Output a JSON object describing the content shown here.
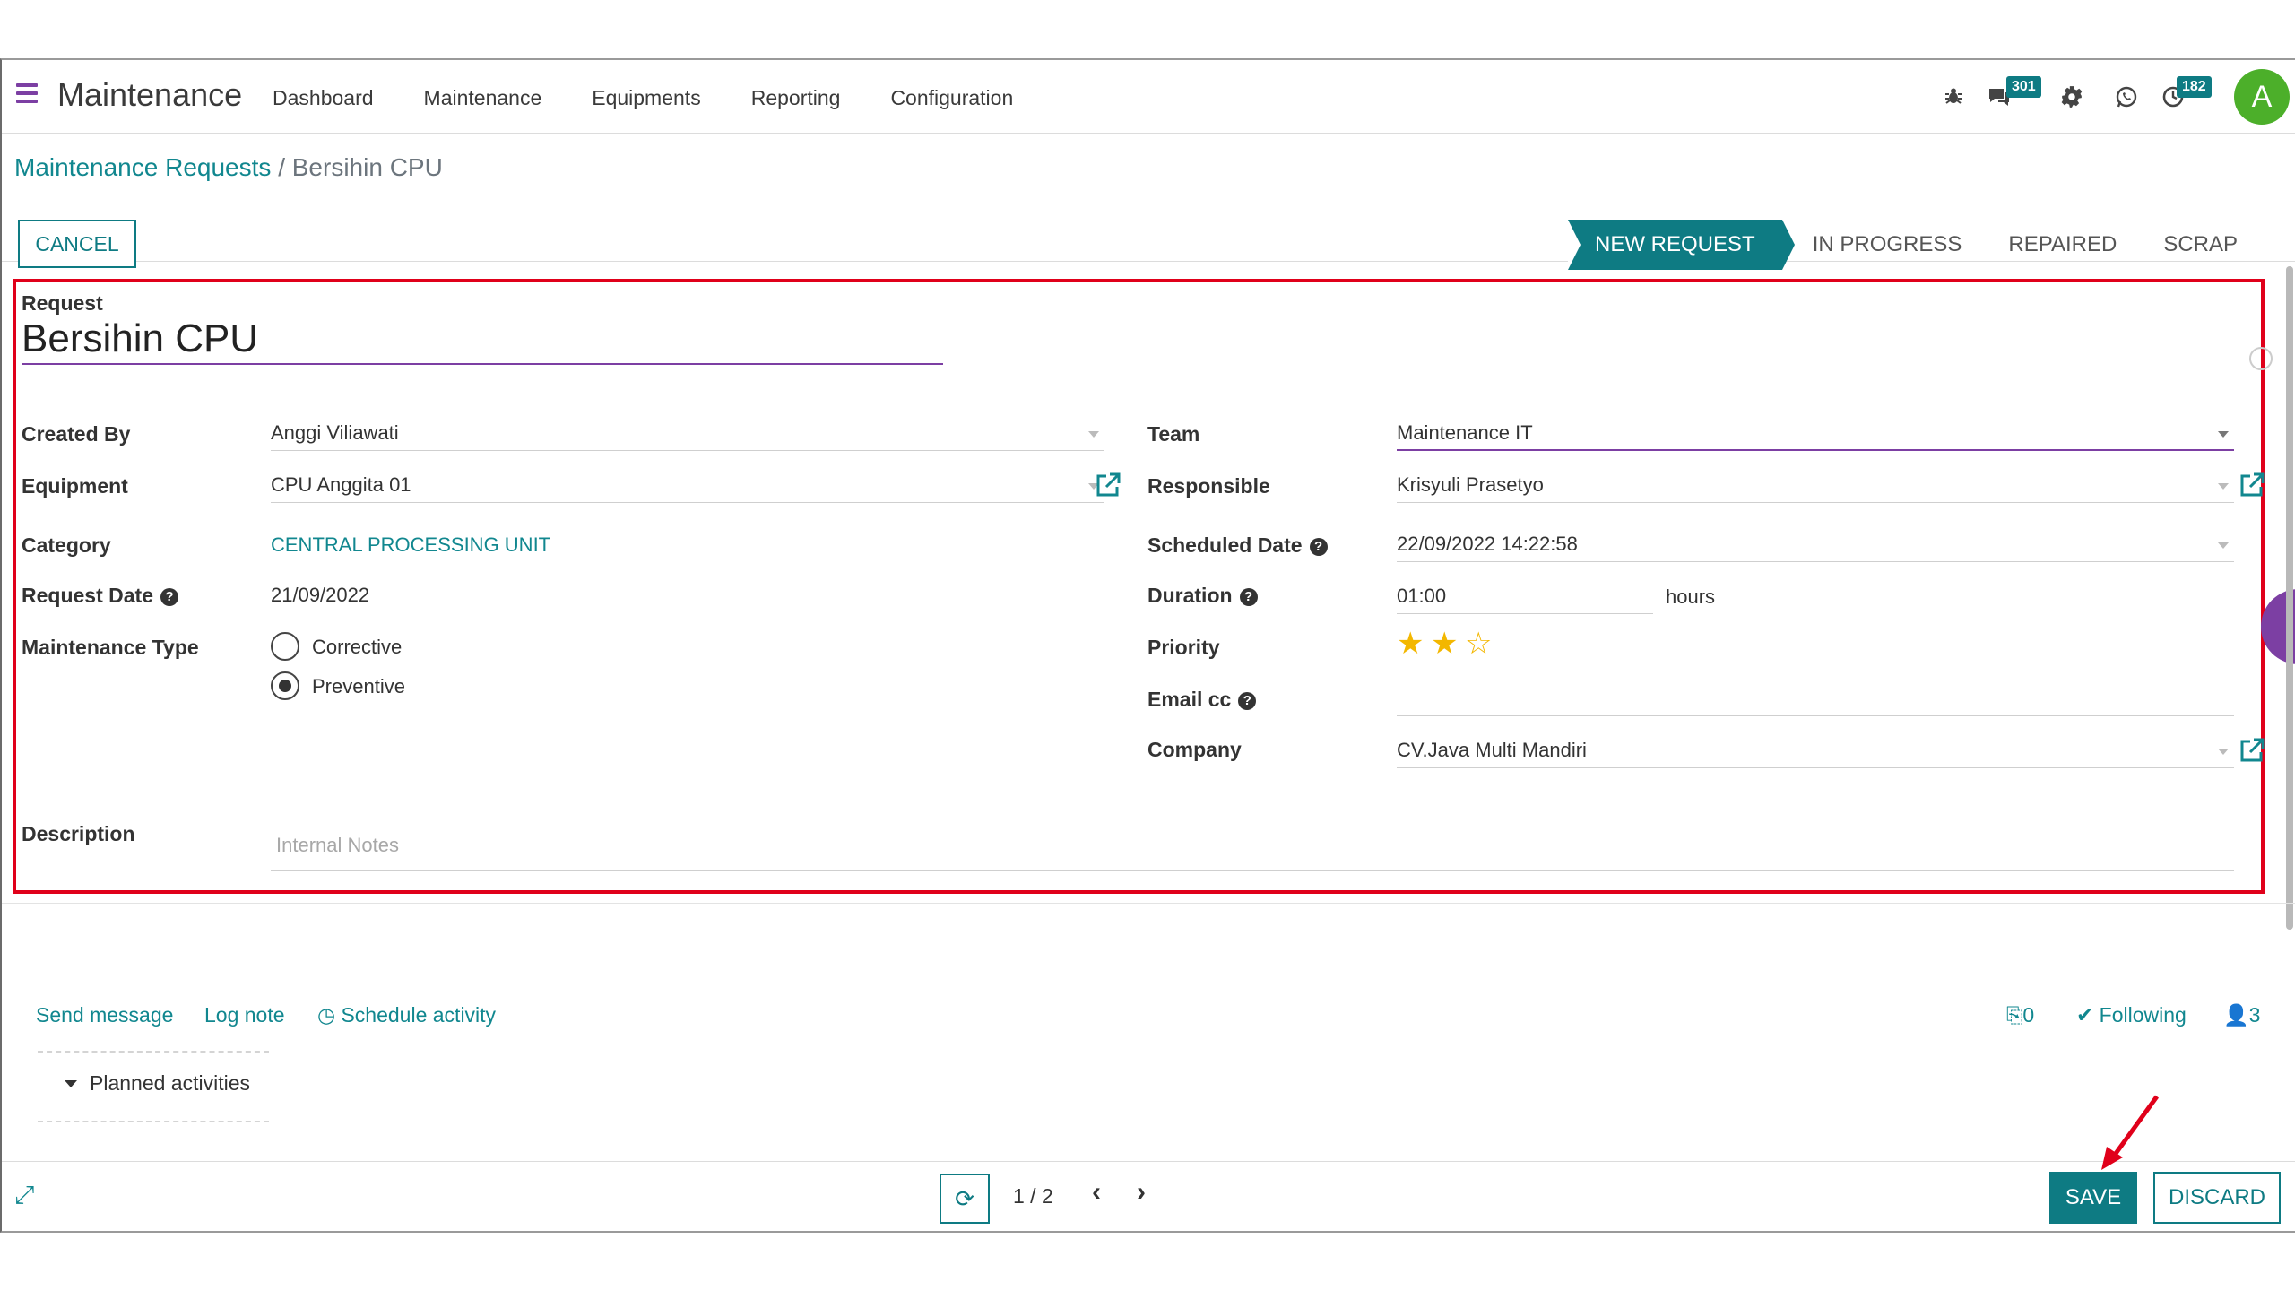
{
  "navbar": {
    "app_title": "Maintenance",
    "menu": [
      "Dashboard",
      "Maintenance",
      "Equipments",
      "Reporting",
      "Configuration"
    ],
    "messages_badge": "301",
    "activities_badge": "182",
    "avatar_initial": "A"
  },
  "breadcrumb": {
    "parent": "Maintenance Requests",
    "separator": "/",
    "current": "Bersihin CPU"
  },
  "actions": {
    "cancel": "CANCEL",
    "save": "SAVE",
    "discard": "DISCARD"
  },
  "stages": [
    "NEW REQUEST",
    "IN PROGRESS",
    "REPAIRED",
    "SCRAP"
  ],
  "form": {
    "request_label": "Request",
    "request_name": "Bersihin CPU",
    "created_by": {
      "label": "Created By",
      "value": "Anggi Viliawati"
    },
    "equipment": {
      "label": "Equipment",
      "value": "CPU Anggita 01"
    },
    "category": {
      "label": "Category",
      "value": "CENTRAL PROCESSING UNIT"
    },
    "request_date": {
      "label": "Request Date",
      "value": "21/09/2022"
    },
    "maintenance_type": {
      "label": "Maintenance Type",
      "options": [
        "Corrective",
        "Preventive"
      ],
      "selected": "Preventive"
    },
    "team": {
      "label": "Team",
      "value": "Maintenance IT"
    },
    "responsible": {
      "label": "Responsible",
      "value": "Krisyuli Prasetyo"
    },
    "scheduled_date": {
      "label": "Scheduled Date",
      "value": "22/09/2022 14:22:58"
    },
    "duration": {
      "label": "Duration",
      "value": "01:00",
      "unit": "hours"
    },
    "priority": {
      "label": "Priority",
      "stars_filled": 2,
      "stars_total": 3
    },
    "email_cc": {
      "label": "Email cc",
      "value": ""
    },
    "company": {
      "label": "Company",
      "value": "CV.Java Multi Mandiri"
    },
    "description": {
      "label": "Description",
      "placeholder": "Internal Notes"
    }
  },
  "chatter": {
    "send_message": "Send message",
    "log_note": "Log note",
    "schedule_activity": "Schedule activity",
    "attachments": "0",
    "following": "Following",
    "followers": "3",
    "planned_activities": "Planned activities"
  },
  "pager": {
    "value": "1 / 2"
  },
  "colors": {
    "accent": "#0e7b83",
    "brand": "#7c3fa3",
    "highlight": "#e0001a",
    "star": "#f3b700"
  }
}
